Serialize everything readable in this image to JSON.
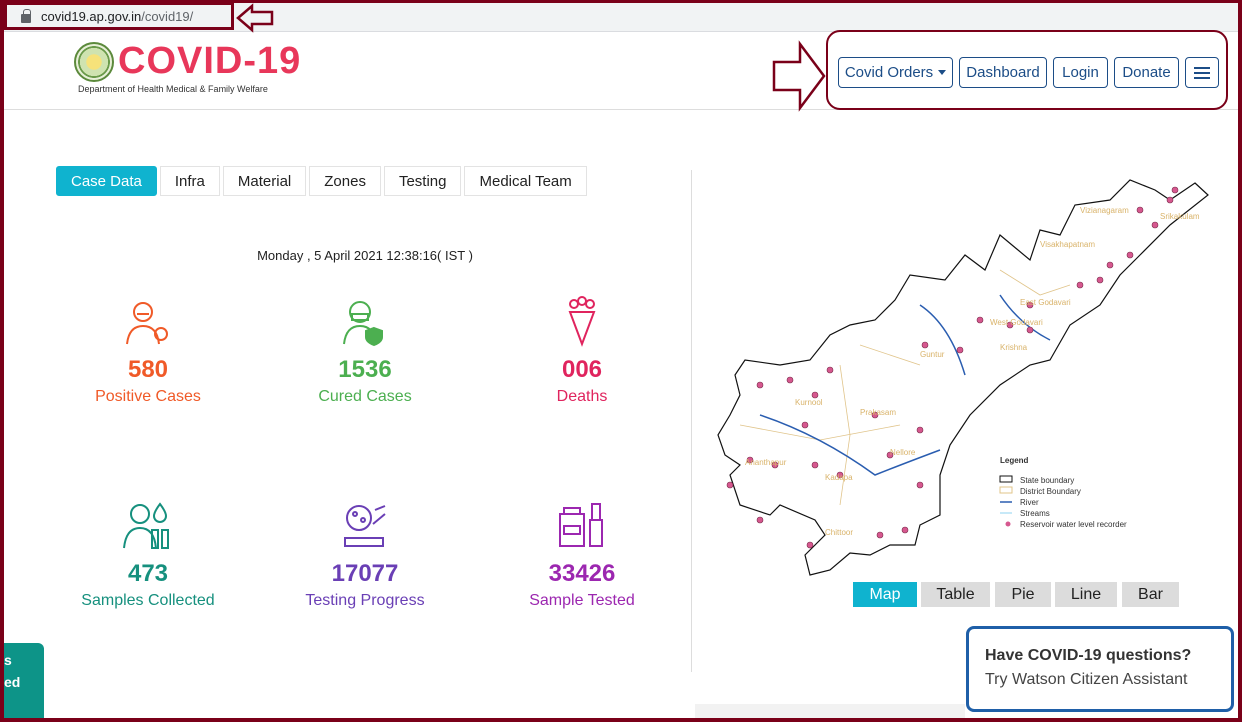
{
  "browser": {
    "url_host": "covid19.ap.gov.in",
    "url_path": "/covid19/"
  },
  "header": {
    "logo_title": "COVID-19",
    "logo_subtitle": "Department of Health Medical & Family Welfare",
    "nav": [
      {
        "label": "Covid Orders"
      },
      {
        "label": "Dashboard"
      },
      {
        "label": "Login"
      },
      {
        "label": "Donate"
      }
    ],
    "menu_icon": "hamburger-icon"
  },
  "tabs": [
    {
      "label": "Case Data",
      "active": true
    },
    {
      "label": "Infra"
    },
    {
      "label": "Material"
    },
    {
      "label": "Zones"
    },
    {
      "label": "Testing"
    },
    {
      "label": "Medical Team"
    }
  ],
  "datetime": "Monday , 5 April 2021  12:38:16( IST )",
  "stats": [
    {
      "value": "580",
      "label": "Positive Cases",
      "color": "#f05a28",
      "icon": "patient-virus-icon"
    },
    {
      "value": "1536",
      "label": "Cured Cases",
      "color": "#4caf50",
      "icon": "person-mask-shield-icon"
    },
    {
      "value": "006",
      "label": "Deaths",
      "color": "#e0245e",
      "icon": "flower-bouquet-icon"
    },
    {
      "value": "473",
      "label": "Samples Collected",
      "color": "#16907e",
      "icon": "doctor-test-tubes-icon"
    },
    {
      "value": "17077",
      "label": "Testing Progress",
      "color": "#6a3fb5",
      "icon": "microscope-petri-icon"
    },
    {
      "value": "33426",
      "label": "Sample Tested",
      "color": "#9c27b0",
      "icon": "lab-jars-icon"
    }
  ],
  "map": {
    "districts": [
      "Vizianagaram",
      "Srikakulam",
      "Visakhapatnam",
      "East Godavari",
      "West Godavari",
      "Krishna",
      "Guntur",
      "Kurnool",
      "Prakasam",
      "Nellore",
      "Ananthapur",
      "Kadapa",
      "Chittoor"
    ],
    "legend": {
      "title": "Legend",
      "items": [
        "State boundary",
        "District Boundary",
        "River",
        "Streams",
        "Reservoir water level recorder"
      ]
    },
    "view_buttons": [
      {
        "label": "Map",
        "active": true
      },
      {
        "label": "Table"
      },
      {
        "label": "Pie"
      },
      {
        "label": "Line"
      },
      {
        "label": "Bar"
      }
    ]
  },
  "watson": {
    "question": "Have COVID-19 questions?",
    "prompt": "Try Watson Citizen Assistant"
  },
  "side_widget": {
    "lines": [
      "s",
      "ed"
    ]
  },
  "colors": {
    "accent": "#0fb3cf",
    "nav_border": "#1c4d87",
    "annotation": "#7a0019",
    "logo": "#e8375a"
  }
}
